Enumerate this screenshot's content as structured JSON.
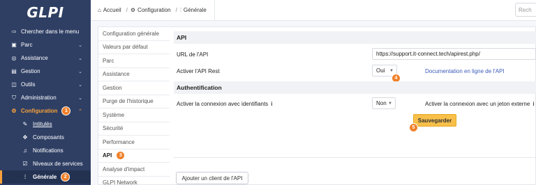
{
  "app": {
    "logo": "GLPI"
  },
  "sidebar": {
    "items": [
      {
        "label": "Chercher dans le menu",
        "icon": "arrow-right-icon"
      },
      {
        "label": "Parc",
        "icon": "box-icon"
      },
      {
        "label": "Assistance",
        "icon": "headset-icon"
      },
      {
        "label": "Gestion",
        "icon": "wallet-icon"
      },
      {
        "label": "Outils",
        "icon": "briefcase-icon"
      },
      {
        "label": "Administration",
        "icon": "shield-icon"
      },
      {
        "label": "Configuration",
        "icon": "gear-icon",
        "badge": "1"
      }
    ],
    "subitems": [
      {
        "label": "Intitulés",
        "icon": "pencil-icon"
      },
      {
        "label": "Composants",
        "icon": "components-icon"
      },
      {
        "label": "Notifications",
        "icon": "bell-icon"
      },
      {
        "label": "Niveaux de services",
        "icon": "checklist-icon"
      },
      {
        "label": "Générale",
        "icon": "sliders-icon",
        "badge": "2"
      }
    ]
  },
  "breadcrumb": {
    "home": "Accueil",
    "config": "Configuration",
    "current": "Générale"
  },
  "search": {
    "placeholder": "Rech"
  },
  "tabs": [
    {
      "label": "Configuration générale"
    },
    {
      "label": "Valeurs par défaut"
    },
    {
      "label": "Parc"
    },
    {
      "label": "Assistance"
    },
    {
      "label": "Gestion"
    },
    {
      "label": "Purge de l'historique"
    },
    {
      "label": "Système"
    },
    {
      "label": "Sécurité"
    },
    {
      "label": "Performance"
    },
    {
      "label": "API",
      "badge": "3"
    },
    {
      "label": "Analyse d'impact"
    },
    {
      "label": "GLPI Network"
    }
  ],
  "api": {
    "section_title": "API",
    "url_label": "URL de l'API",
    "url_value": "https://support.it-connect.tech/apirest.php/",
    "rest_label": "Activer l'API Rest",
    "rest_value": "Oui",
    "rest_badge": "4",
    "doc_link": "Documentation en ligne de l'API"
  },
  "auth": {
    "section_title": "Authentification",
    "credentials_label": "Activer la connexion avec identifiants",
    "credentials_value": "Non",
    "token_label": "Activer la connexion avec un jeton externe",
    "info_icon": "i"
  },
  "actions": {
    "save_label": "Sauvegarder",
    "save_badge": "5",
    "add_client_label": "Ajouter un client de l'API"
  },
  "colors": {
    "sidebar_bg": "#2f3f64",
    "accent": "#f8a13a",
    "save_bg": "#f8c04a",
    "link": "#3b5ab9"
  }
}
